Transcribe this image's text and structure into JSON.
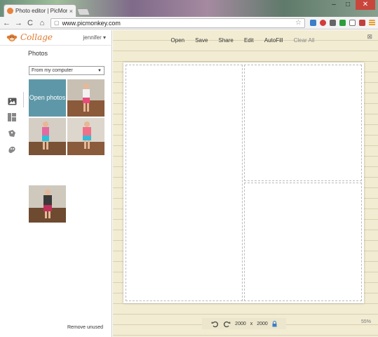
{
  "browser": {
    "tab_title": "Photo editor | PicMonkey",
    "tab_close": "×",
    "url": "www.picmonkey.com",
    "window_controls": {
      "minimize": "–",
      "maximize": "□",
      "close": "✕"
    },
    "nav": {
      "back": "←",
      "forward": "→",
      "reload": "C",
      "home": "⌂"
    },
    "extensions": [
      "bookmark-star-icon",
      "shield-ext-icon",
      "pinterest-icon",
      "photo-ext-icon",
      "feedly-icon",
      "cast-icon",
      "pdf-ext-icon",
      "menu-icon"
    ],
    "extension_colors": [
      "#3c7ec8",
      "#d23c3c",
      "#666666",
      "#2e9e3c",
      "#777777",
      "#c04040",
      "#e8a030"
    ]
  },
  "sidebar": {
    "logo_text": "Collage",
    "user": "jennifer ▾",
    "title": "Photos",
    "source_select": {
      "value": "From my computer",
      "caret": "▼"
    },
    "open_photos_label": "Open photos",
    "thumbnails": [
      "photo-1",
      "photo-2",
      "photo-3",
      "photo-4",
      "photo-5"
    ],
    "remove_unused": "Remove unused",
    "tools": [
      "image-icon",
      "layouts-icon",
      "stickers-icon",
      "backgrounds-icon"
    ]
  },
  "editor": {
    "menu": [
      {
        "label": "Open",
        "enabled": true
      },
      {
        "label": "Save",
        "enabled": true
      },
      {
        "label": "Share",
        "enabled": true
      },
      {
        "label": "Edit",
        "enabled": true
      },
      {
        "label": "AutoFill",
        "enabled": true
      },
      {
        "label": "Clear All",
        "enabled": false
      }
    ],
    "close": "⊠",
    "canvas": {
      "width": "2000",
      "height": "2000",
      "times": "x"
    },
    "zoom": "55%"
  }
}
